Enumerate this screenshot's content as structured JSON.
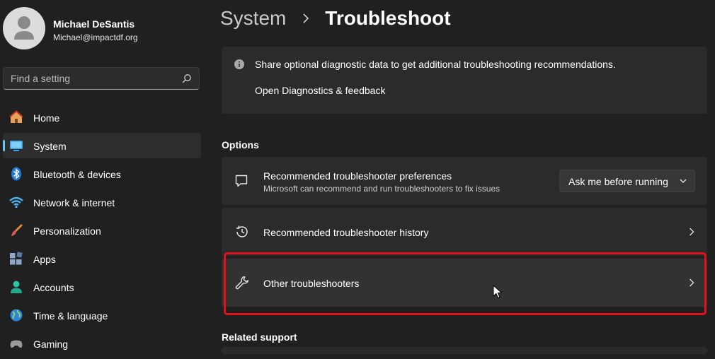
{
  "user": {
    "name": "Michael DeSantis",
    "email": "Michael@impactdf.org"
  },
  "search": {
    "placeholder": "Find a setting",
    "icon": "search-icon"
  },
  "sidebar": {
    "items": [
      {
        "label": "Home",
        "icon": "home-icon",
        "active": false
      },
      {
        "label": "System",
        "icon": "system-icon",
        "active": true
      },
      {
        "label": "Bluetooth & devices",
        "icon": "bluetooth-icon",
        "active": false
      },
      {
        "label": "Network & internet",
        "icon": "wifi-icon",
        "active": false
      },
      {
        "label": "Personalization",
        "icon": "brush-icon",
        "active": false
      },
      {
        "label": "Apps",
        "icon": "apps-icon",
        "active": false
      },
      {
        "label": "Accounts",
        "icon": "accounts-icon",
        "active": false
      },
      {
        "label": "Time & language",
        "icon": "globe-icon",
        "active": false
      },
      {
        "label": "Gaming",
        "icon": "gaming-icon",
        "active": false
      }
    ]
  },
  "breadcrumb": {
    "parent": "System",
    "current": "Troubleshoot"
  },
  "info": {
    "text": "Share optional diagnostic data to get additional troubleshooting recommendations.",
    "link": "Open Diagnostics & feedback"
  },
  "options": {
    "title": "Options",
    "items": [
      {
        "title": "Recommended troubleshooter preferences",
        "subtitle": "Microsoft can recommend and run troubleshooters to fix issues",
        "icon": "chat-icon",
        "control": {
          "type": "dropdown",
          "value": "Ask me before running"
        }
      },
      {
        "title": "Recommended troubleshooter history",
        "icon": "history-icon",
        "control": {
          "type": "chevron"
        }
      },
      {
        "title": "Other troubleshooters",
        "icon": "wrench-icon",
        "control": {
          "type": "chevron"
        },
        "highlighted": true
      }
    ]
  },
  "related": {
    "title": "Related support"
  },
  "colors": {
    "background": "#202020",
    "card": "#2b2b2b",
    "accent": "#6dc5f1",
    "highlight_outline": "#e3111b"
  }
}
